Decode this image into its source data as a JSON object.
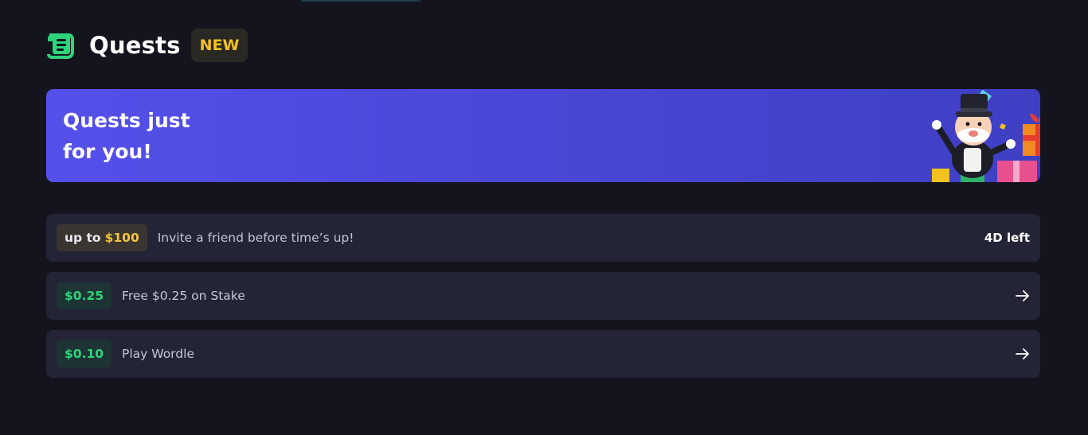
{
  "header": {
    "title": "Quests",
    "badge": "NEW",
    "icon": "scroll-icon"
  },
  "banner": {
    "text": "Quests just\nfor you!",
    "illustration": "mascot-with-gifts-illustration"
  },
  "quests": [
    {
      "reward_prefix": "up to",
      "reward_amount": "$100",
      "label": "Invite a friend before time’s up!",
      "status": "4D left"
    },
    {
      "reward_amount": "$0.25",
      "label": "Free $0.25 on Stake",
      "action_icon": "arrow-right-icon"
    },
    {
      "reward_amount": "$0.10",
      "label": "Play Wordle",
      "action_icon": "arrow-right-icon"
    }
  ],
  "colors": {
    "background": "#14141f",
    "card": "#232536",
    "accent_green": "#2ed47a",
    "badge_gold": "#f4c21f",
    "banner_blue": "#4b47d9"
  }
}
